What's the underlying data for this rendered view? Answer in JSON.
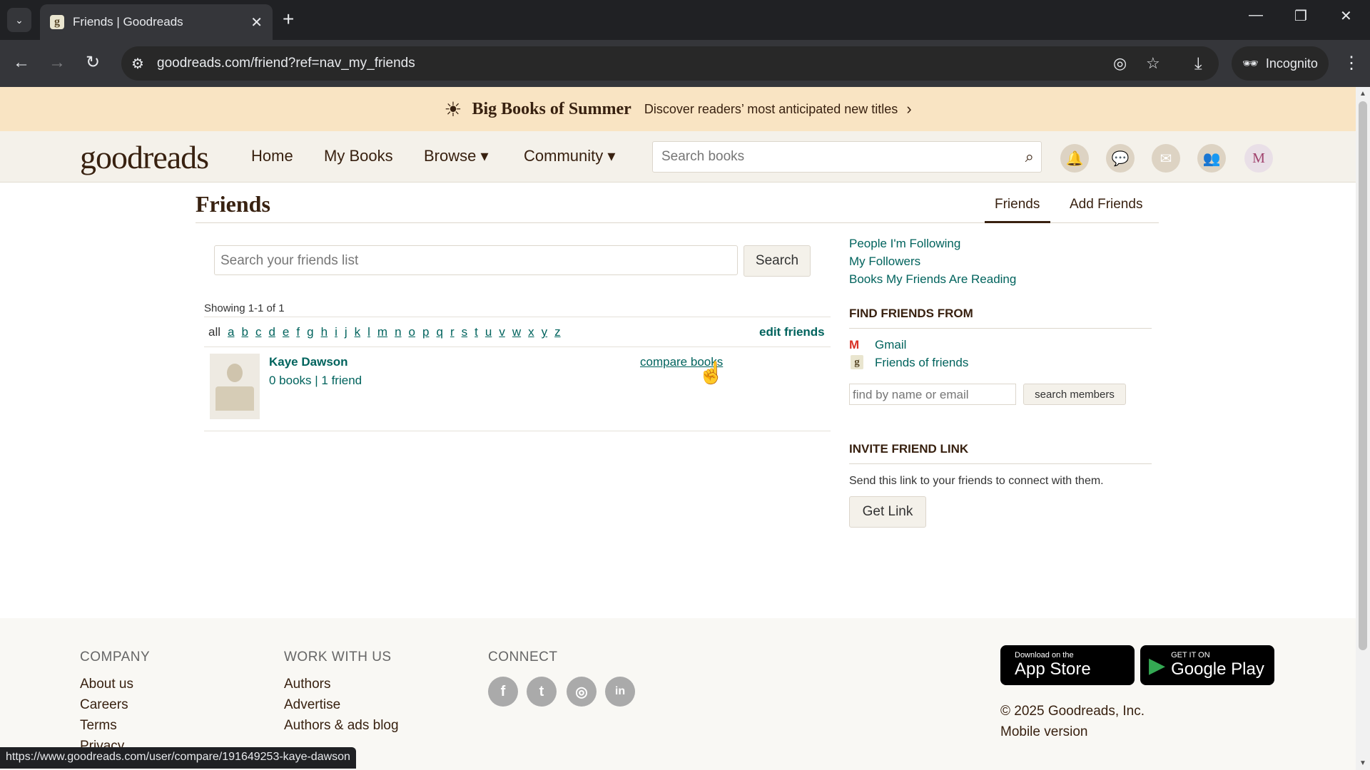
{
  "browser": {
    "tab_title": "Friends | Goodreads",
    "tab_favicon_letter": "g",
    "url": "goodreads.com/friend?ref=nav_my_friends",
    "incognito_label": "Incognito",
    "status_url": "https://www.goodreads.com/user/compare/191649253-kaye-dawson"
  },
  "promo": {
    "title": "Big Books of Summer",
    "text": "Discover readers’ most anticipated new titles"
  },
  "header": {
    "logo": "goodreads",
    "nav": [
      "Home",
      "My Books",
      "Browse ▾",
      "Community ▾"
    ],
    "search_placeholder": "Search books",
    "avatar_letter": "M"
  },
  "main": {
    "title": "Friends",
    "tabs": [
      "Friends",
      "Add Friends"
    ],
    "search_placeholder": "Search your friends list",
    "search_button": "Search",
    "showing": "Showing 1-1 of 1",
    "alphabet": [
      "all",
      "a",
      "b",
      "c",
      "d",
      "e",
      "f",
      "g",
      "h",
      "i",
      "j",
      "k",
      "l",
      "m",
      "n",
      "o",
      "p",
      "q",
      "r",
      "s",
      "t",
      "u",
      "v",
      "w",
      "x",
      "y",
      "z"
    ],
    "edit_friends": "edit friends",
    "friends": [
      {
        "name": "Kaye Dawson",
        "stats": "0 books | 1 friend",
        "compare": "compare books"
      }
    ]
  },
  "sidebar": {
    "links": [
      "People I'm Following",
      "My Followers",
      "Books My Friends Are Reading"
    ],
    "find_heading": "FIND FRIENDS FROM",
    "find_sources": [
      "Gmail",
      "Friends of friends"
    ],
    "find_placeholder": "find by name or email",
    "search_members": "search members",
    "invite_heading": "INVITE FRIEND LINK",
    "invite_text": "Send this link to your friends to connect with them.",
    "get_link": "Get Link"
  },
  "footer": {
    "company_heading": "Company",
    "company_links": [
      "About us",
      "Careers",
      "Terms",
      "Privacy"
    ],
    "work_heading": "Work with us",
    "work_links": [
      "Authors",
      "Advertise",
      "Authors & ads blog"
    ],
    "connect_heading": "Connect",
    "social": [
      "f",
      "t",
      "◎",
      "in"
    ],
    "app_store_small": "Download on the",
    "app_store_big": "App Store",
    "google_play_small": "GET IT ON",
    "google_play_big": "Google Play",
    "copyright": "© 2025 Goodreads, Inc.",
    "mobile_version": "Mobile version"
  },
  "colors": {
    "promo_bg": "#f9e4c3",
    "header_bg": "#f4f1ea",
    "brand": "#382110",
    "link": "#00635d"
  }
}
